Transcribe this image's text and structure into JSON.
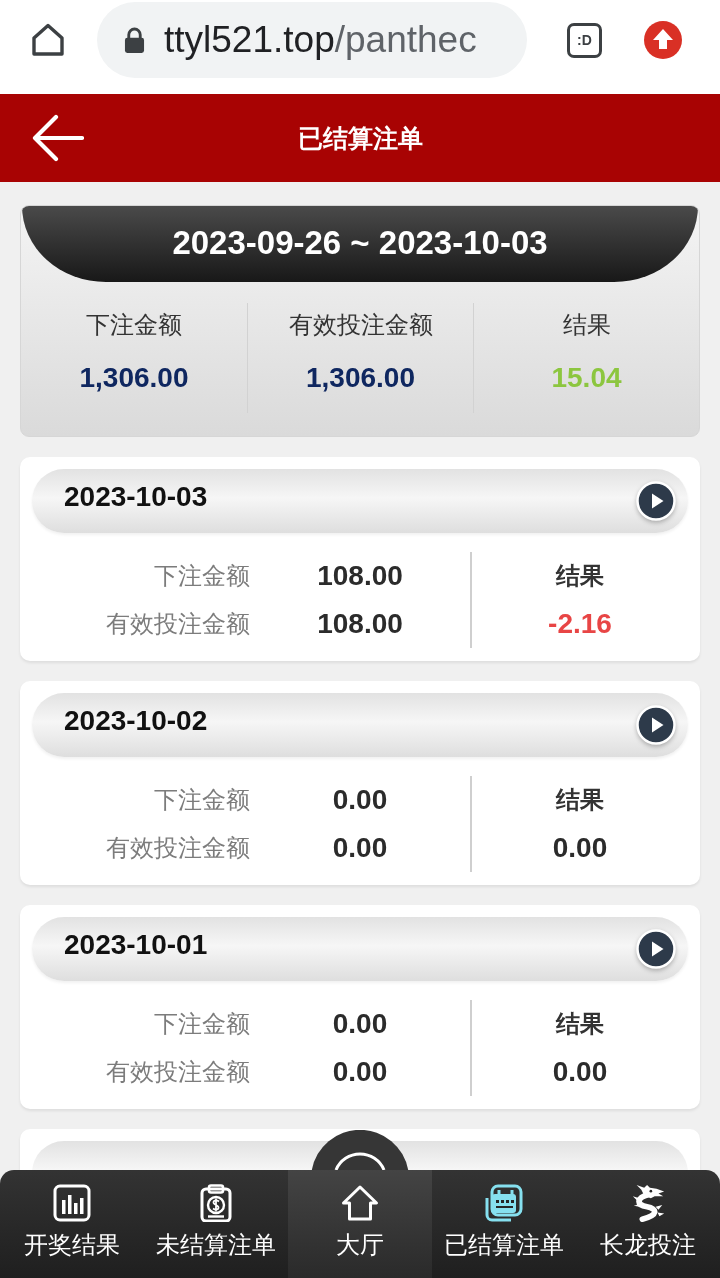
{
  "browser": {
    "url_host": "ttyl521.top",
    "url_path": "/panthec",
    "tab_count": ":D"
  },
  "header": {
    "title": "已结算注单"
  },
  "summary": {
    "range": "2023-09-26 ~ 2023-10-03",
    "stats": [
      {
        "label": "下注金额",
        "value": "1,306.00",
        "kind": "amount"
      },
      {
        "label": "有效投注金额",
        "value": "1,306.00",
        "kind": "amount"
      },
      {
        "label": "结果",
        "value": "15.04",
        "kind": "result"
      }
    ]
  },
  "days": [
    {
      "date": "2023-10-03",
      "rows": [
        {
          "label": "下注金额",
          "value": "108.00"
        },
        {
          "label": "有效投注金额",
          "value": "108.00"
        }
      ],
      "result_label": "结果",
      "result": "-2.16",
      "color": "#e84545"
    },
    {
      "date": "2023-10-02",
      "rows": [
        {
          "label": "下注金额",
          "value": "0.00"
        },
        {
          "label": "有效投注金额",
          "value": "0.00"
        }
      ],
      "result_label": "结果",
      "result": "0.00",
      "color": "#2b2b2b"
    },
    {
      "date": "2023-10-01",
      "rows": [
        {
          "label": "下注金额",
          "value": "0.00"
        },
        {
          "label": "有效投注金额",
          "value": "0.00"
        }
      ],
      "result_label": "结果",
      "result": "0.00",
      "color": "#2b2b2b"
    }
  ],
  "more_days_below": true,
  "nav": [
    {
      "label": "开奖结果",
      "kind": "chart",
      "selected": false
    },
    {
      "label": "未结算注单",
      "kind": "clipboard",
      "selected": false
    },
    {
      "label": "大厅",
      "kind": "home",
      "selected": false
    },
    {
      "label": "已结算注单",
      "kind": "calendar",
      "selected": true
    },
    {
      "label": "长龙投注",
      "kind": "dragon",
      "selected": false
    }
  ]
}
